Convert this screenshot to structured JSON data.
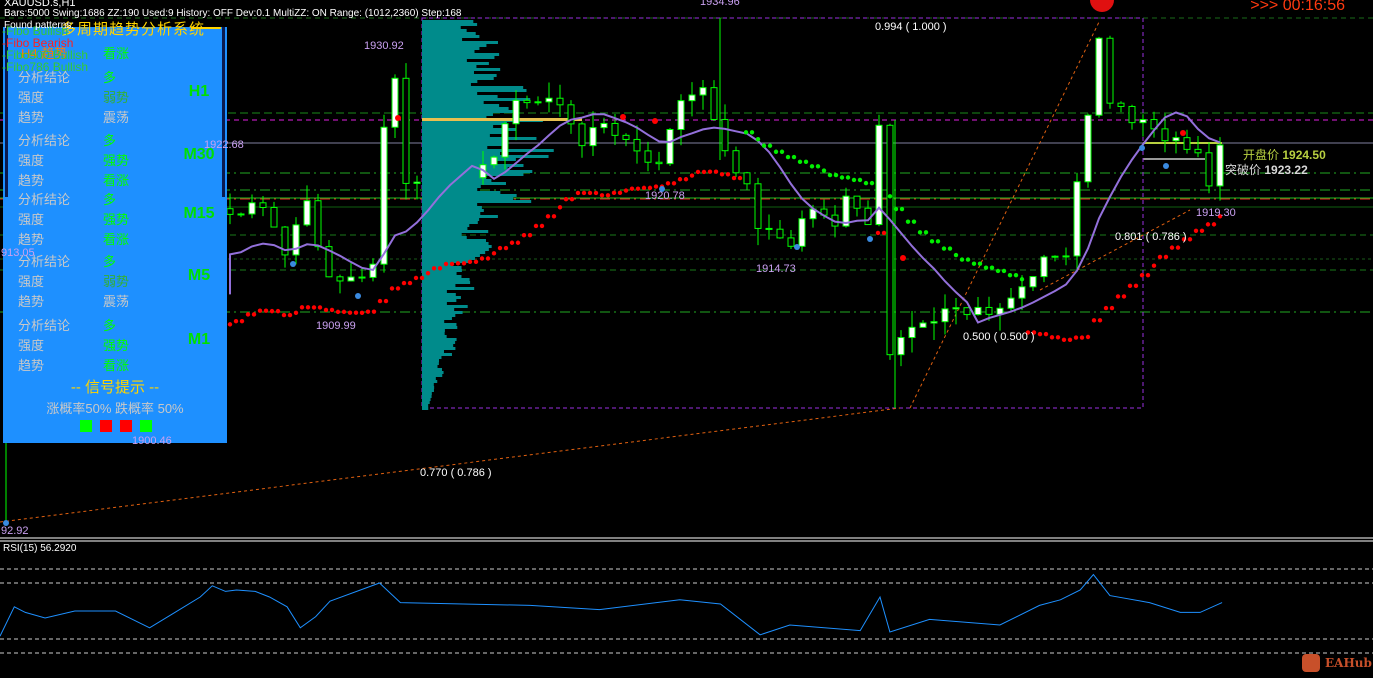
{
  "header": {
    "symbol": "XAUUSD.s,H1",
    "info": "Bars:5000  Swing:1686  ZZ:190  Used:9  History: OFF Dev:0.1  MultiZZ: ON  Range: (1012,2360)  Step:168",
    "found": "Found patterns:"
  },
  "timer": ">>> 00:16:56",
  "fib_legend": [
    {
      "text": "-Fibo Bullish",
      "color": "#33cc33"
    },
    {
      "text": "-Fibo Bearish",
      "color": "#ff2020"
    },
    {
      "text": "-Fibo500 Bullish",
      "color": "#33cc33"
    },
    {
      "text": "-Fibo786 Bullish",
      "color": "#33cc33"
    }
  ],
  "panel": {
    "title": "多周期趋势分析系统",
    "h4_label": "H4 趋势",
    "h4_value": "看涨",
    "timeframes": [
      {
        "tf": "H1",
        "conclusion_label": "分析结论",
        "conclusion": "多",
        "strength_label": "强度",
        "strength": "弱势",
        "trend_label": "趋势",
        "trend": "震荡",
        "strength_color": "#33b033",
        "trend_color": "#c8c8c8"
      },
      {
        "tf": "M30",
        "conclusion_label": "分析结论",
        "conclusion": "多",
        "strength_label": "强度",
        "strength": "强势",
        "trend_label": "趋势",
        "trend": "看涨",
        "strength_color": "#00ff00",
        "trend_color": "#00ff00"
      },
      {
        "tf": "M15",
        "conclusion_label": "分析结论",
        "conclusion": "多",
        "strength_label": "强度",
        "strength": "强势",
        "trend_label": "趋势",
        "trend": "看涨",
        "strength_color": "#00ff00",
        "trend_color": "#00ff00"
      },
      {
        "tf": "M5",
        "conclusion_label": "分析结论",
        "conclusion": "多",
        "strength_label": "强度",
        "strength": "弱势",
        "trend_label": "趋势",
        "trend": "震荡",
        "strength_color": "#33b033",
        "trend_color": "#c8c8c8"
      },
      {
        "tf": "M1",
        "conclusion_label": "分析结论",
        "conclusion": "多",
        "strength_label": "强度",
        "strength": "强势",
        "trend_label": "趋势",
        "trend": "看涨",
        "strength_color": "#00ff00",
        "trend_color": "#00ff00"
      }
    ],
    "signal_title": "--  信号提示  --",
    "probability": "涨概率50% 跌概率 50%",
    "signal_squares": [
      "#00ff00",
      "#ff0000",
      "#ff0000",
      "#00ff00"
    ]
  },
  "price_labels": {
    "p1934": "1934.96",
    "p1930": "1930.92",
    "p1922": "1922.68",
    "p1913": "913.05",
    "p1909": "1909.99",
    "p1920": "1920.78",
    "p1914": "1914.73",
    "p1900": "1900.46",
    "p1892": "92.92",
    "p1919": "1919.30"
  },
  "fib_levels": {
    "f1": "0.994 ( 1.000 )",
    "f2": "0.801 ( 0.786 )",
    "f3": "0.500 ( 0.500 )",
    "f4": "0.770 ( 0.786 )"
  },
  "open_price": {
    "label": "开盘价",
    "value": "1924.50"
  },
  "break_price": {
    "label": "突破价",
    "value": "1923.22"
  },
  "rsi": {
    "label": "RSI(15) 56.2920",
    "levels": [
      80,
      70,
      30,
      20
    ],
    "points": [
      [
        0,
        32
      ],
      [
        1.3,
        53
      ],
      [
        2.3,
        49
      ],
      [
        4.1,
        45
      ],
      [
        6.8,
        50
      ],
      [
        10.5,
        50
      ],
      [
        13.6,
        38
      ],
      [
        15.9,
        49
      ],
      [
        18.2,
        60
      ],
      [
        19.3,
        68
      ],
      [
        20.5,
        64
      ],
      [
        21.5,
        65
      ],
      [
        23.2,
        64
      ],
      [
        24.5,
        60
      ],
      [
        26.1,
        53
      ],
      [
        27.3,
        38
      ],
      [
        28.7,
        46
      ],
      [
        30,
        57
      ],
      [
        34.5,
        70
      ],
      [
        36.4,
        56
      ],
      [
        48.2,
        54
      ],
      [
        54.5,
        51
      ],
      [
        61.8,
        58
      ],
      [
        65.5,
        55
      ],
      [
        69.1,
        33
      ],
      [
        71.8,
        40
      ],
      [
        78.2,
        36
      ],
      [
        80,
        60
      ],
      [
        80.9,
        35
      ],
      [
        84.5,
        44
      ],
      [
        90.9,
        40
      ],
      [
        94.5,
        54
      ],
      [
        96.4,
        58
      ],
      [
        98.2,
        65
      ],
      [
        99.4,
        76
      ],
      [
        100.9,
        61
      ],
      [
        104.5,
        56
      ],
      [
        107.3,
        49
      ],
      [
        109.1,
        49
      ],
      [
        111.1,
        56
      ]
    ]
  },
  "price_path": [
    [
      0,
      1918.8
    ],
    [
      3,
      1919.5
    ],
    [
      5,
      1915.3
    ],
    [
      7,
      1919.7
    ],
    [
      9,
      1912.6
    ],
    [
      11,
      1912.6
    ],
    [
      13,
      1913.5
    ],
    [
      14,
      1925.8
    ],
    [
      15,
      1930.2
    ],
    [
      16,
      1921.4
    ],
    [
      17,
      1921.4
    ],
    [
      21,
      1921
    ],
    [
      24,
      1924
    ],
    [
      26,
      1928.5
    ],
    [
      30,
      1928
    ],
    [
      32,
      1924.9
    ],
    [
      34,
      1926.2
    ],
    [
      36,
      1924.5
    ],
    [
      39,
      1922.3
    ],
    [
      41,
      1928.5
    ],
    [
      43,
      1929.3
    ],
    [
      45,
      1923.5
    ],
    [
      47,
      1920.5
    ],
    [
      48,
      1917
    ],
    [
      51,
      1916.1
    ],
    [
      53,
      1918.8
    ],
    [
      55,
      1917.5
    ],
    [
      56,
      1919.7
    ],
    [
      58,
      1917.5
    ],
    [
      59,
      1926.3
    ],
    [
      60,
      1905.6
    ],
    [
      62,
      1909
    ],
    [
      64,
      1909
    ],
    [
      66,
      1910
    ],
    [
      69,
      1910
    ],
    [
      71,
      1911
    ],
    [
      73,
      1913.5
    ],
    [
      76,
      1915.3
    ],
    [
      77,
      1921.4
    ],
    [
      78,
      1927.5
    ],
    [
      79,
      1933.7
    ],
    [
      80,
      1928.5
    ],
    [
      82,
      1926.7
    ],
    [
      84,
      1925.8
    ],
    [
      85,
      1925
    ],
    [
      87,
      1924.5
    ],
    [
      88,
      1924
    ],
    [
      89,
      1921
    ],
    [
      90,
      1924.5
    ]
  ],
  "colors": {
    "panel": "#1e90ff",
    "candle": "#00ff00",
    "ma": "#9370db",
    "sar_up": "#ff0000",
    "sar_down": "#00ee00",
    "profile": "#008b8b",
    "rsi": "#1e90ff"
  },
  "brand": "EAHub"
}
